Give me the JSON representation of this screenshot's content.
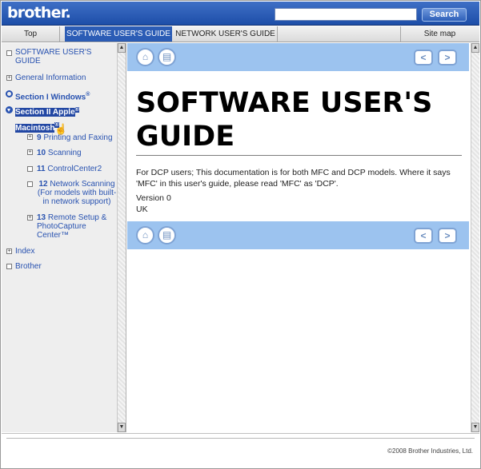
{
  "header": {
    "logo": "brother.",
    "search_placeholder": "",
    "search_button": "Search"
  },
  "tabs": [
    {
      "label": "Top",
      "active": false
    },
    {
      "label": "SOFTWARE USER'S GUIDE",
      "active": true
    },
    {
      "label": "NETWORK USER'S GUIDE",
      "active": false
    },
    {
      "label": "Site map",
      "active": false
    }
  ],
  "sidebar": {
    "items": [
      {
        "label": "SOFTWARE USER'S GUIDE"
      },
      {
        "label": "General Information"
      },
      {
        "label": "Section I Windows",
        "sup": "®"
      },
      {
        "label": "Section II Apple",
        "sup": "®",
        "line2": "Macintosh",
        "sup2": "®"
      },
      {
        "num": "9",
        "label": "Printing and Faxing"
      },
      {
        "num": "10",
        "label": "Scanning"
      },
      {
        "num": "11",
        "label": "ControlCenter2"
      },
      {
        "num": "12",
        "label": "Network Scanning",
        "line2": "(For models with built-",
        "line3": "in network support)"
      },
      {
        "num": "13",
        "label": "Remote Setup &",
        "line2": "PhotoCapture",
        "line3": "Center™"
      },
      {
        "label": "Index"
      },
      {
        "label": "Brother"
      }
    ]
  },
  "main": {
    "title_line1": "SOFTWARE USER'S",
    "title_line2": "GUIDE",
    "body_line1": "For DCP users; This documentation is for both MFC and DCP models. Where it says",
    "body_line2": "'MFC' in this user's guide, please read 'MFC' as 'DCP'.",
    "version": "Version 0",
    "country": "UK"
  },
  "footer": {
    "copyright": "©2008 Brother Industries, Ltd."
  },
  "colors": {
    "header_blue": "#2b5cb5",
    "nav_link": "#2852b0",
    "toolbar_blue": "#9cc3ef"
  }
}
